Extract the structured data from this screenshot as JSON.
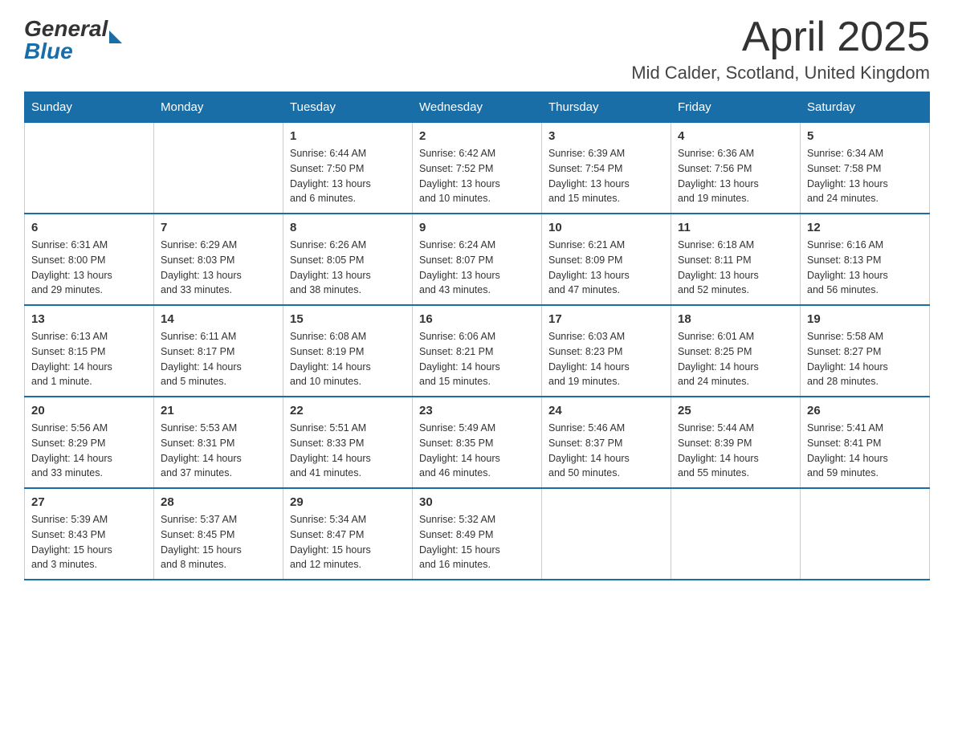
{
  "logo": {
    "general": "General",
    "blue": "Blue"
  },
  "title": "April 2025",
  "subtitle": "Mid Calder, Scotland, United Kingdom",
  "days_of_week": [
    "Sunday",
    "Monday",
    "Tuesday",
    "Wednesday",
    "Thursday",
    "Friday",
    "Saturday"
  ],
  "weeks": [
    [
      {
        "num": "",
        "info": ""
      },
      {
        "num": "",
        "info": ""
      },
      {
        "num": "1",
        "info": "Sunrise: 6:44 AM\nSunset: 7:50 PM\nDaylight: 13 hours\nand 6 minutes."
      },
      {
        "num": "2",
        "info": "Sunrise: 6:42 AM\nSunset: 7:52 PM\nDaylight: 13 hours\nand 10 minutes."
      },
      {
        "num": "3",
        "info": "Sunrise: 6:39 AM\nSunset: 7:54 PM\nDaylight: 13 hours\nand 15 minutes."
      },
      {
        "num": "4",
        "info": "Sunrise: 6:36 AM\nSunset: 7:56 PM\nDaylight: 13 hours\nand 19 minutes."
      },
      {
        "num": "5",
        "info": "Sunrise: 6:34 AM\nSunset: 7:58 PM\nDaylight: 13 hours\nand 24 minutes."
      }
    ],
    [
      {
        "num": "6",
        "info": "Sunrise: 6:31 AM\nSunset: 8:00 PM\nDaylight: 13 hours\nand 29 minutes."
      },
      {
        "num": "7",
        "info": "Sunrise: 6:29 AM\nSunset: 8:03 PM\nDaylight: 13 hours\nand 33 minutes."
      },
      {
        "num": "8",
        "info": "Sunrise: 6:26 AM\nSunset: 8:05 PM\nDaylight: 13 hours\nand 38 minutes."
      },
      {
        "num": "9",
        "info": "Sunrise: 6:24 AM\nSunset: 8:07 PM\nDaylight: 13 hours\nand 43 minutes."
      },
      {
        "num": "10",
        "info": "Sunrise: 6:21 AM\nSunset: 8:09 PM\nDaylight: 13 hours\nand 47 minutes."
      },
      {
        "num": "11",
        "info": "Sunrise: 6:18 AM\nSunset: 8:11 PM\nDaylight: 13 hours\nand 52 minutes."
      },
      {
        "num": "12",
        "info": "Sunrise: 6:16 AM\nSunset: 8:13 PM\nDaylight: 13 hours\nand 56 minutes."
      }
    ],
    [
      {
        "num": "13",
        "info": "Sunrise: 6:13 AM\nSunset: 8:15 PM\nDaylight: 14 hours\nand 1 minute."
      },
      {
        "num": "14",
        "info": "Sunrise: 6:11 AM\nSunset: 8:17 PM\nDaylight: 14 hours\nand 5 minutes."
      },
      {
        "num": "15",
        "info": "Sunrise: 6:08 AM\nSunset: 8:19 PM\nDaylight: 14 hours\nand 10 minutes."
      },
      {
        "num": "16",
        "info": "Sunrise: 6:06 AM\nSunset: 8:21 PM\nDaylight: 14 hours\nand 15 minutes."
      },
      {
        "num": "17",
        "info": "Sunrise: 6:03 AM\nSunset: 8:23 PM\nDaylight: 14 hours\nand 19 minutes."
      },
      {
        "num": "18",
        "info": "Sunrise: 6:01 AM\nSunset: 8:25 PM\nDaylight: 14 hours\nand 24 minutes."
      },
      {
        "num": "19",
        "info": "Sunrise: 5:58 AM\nSunset: 8:27 PM\nDaylight: 14 hours\nand 28 minutes."
      }
    ],
    [
      {
        "num": "20",
        "info": "Sunrise: 5:56 AM\nSunset: 8:29 PM\nDaylight: 14 hours\nand 33 minutes."
      },
      {
        "num": "21",
        "info": "Sunrise: 5:53 AM\nSunset: 8:31 PM\nDaylight: 14 hours\nand 37 minutes."
      },
      {
        "num": "22",
        "info": "Sunrise: 5:51 AM\nSunset: 8:33 PM\nDaylight: 14 hours\nand 41 minutes."
      },
      {
        "num": "23",
        "info": "Sunrise: 5:49 AM\nSunset: 8:35 PM\nDaylight: 14 hours\nand 46 minutes."
      },
      {
        "num": "24",
        "info": "Sunrise: 5:46 AM\nSunset: 8:37 PM\nDaylight: 14 hours\nand 50 minutes."
      },
      {
        "num": "25",
        "info": "Sunrise: 5:44 AM\nSunset: 8:39 PM\nDaylight: 14 hours\nand 55 minutes."
      },
      {
        "num": "26",
        "info": "Sunrise: 5:41 AM\nSunset: 8:41 PM\nDaylight: 14 hours\nand 59 minutes."
      }
    ],
    [
      {
        "num": "27",
        "info": "Sunrise: 5:39 AM\nSunset: 8:43 PM\nDaylight: 15 hours\nand 3 minutes."
      },
      {
        "num": "28",
        "info": "Sunrise: 5:37 AM\nSunset: 8:45 PM\nDaylight: 15 hours\nand 8 minutes."
      },
      {
        "num": "29",
        "info": "Sunrise: 5:34 AM\nSunset: 8:47 PM\nDaylight: 15 hours\nand 12 minutes."
      },
      {
        "num": "30",
        "info": "Sunrise: 5:32 AM\nSunset: 8:49 PM\nDaylight: 15 hours\nand 16 minutes."
      },
      {
        "num": "",
        "info": ""
      },
      {
        "num": "",
        "info": ""
      },
      {
        "num": "",
        "info": ""
      }
    ]
  ]
}
